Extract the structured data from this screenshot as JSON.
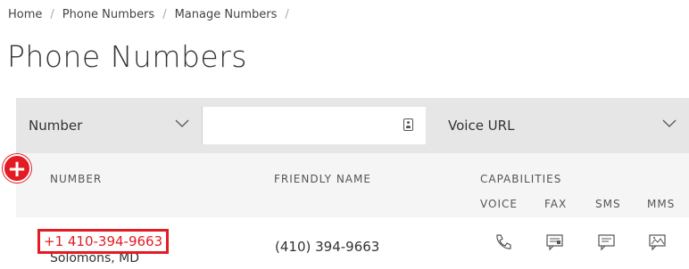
{
  "breadcrumb": {
    "items": [
      "Home",
      "Phone Numbers",
      "Manage Numbers"
    ],
    "separator": "/"
  },
  "page": {
    "title": "Phone Numbers"
  },
  "filters": {
    "field_select": {
      "value": "Number"
    },
    "search": {
      "value": "",
      "placeholder": ""
    },
    "url_select": {
      "value": "Voice URL"
    }
  },
  "table": {
    "headers": {
      "number": "NUMBER",
      "friendly_name": "FRIENDLY NAME",
      "capabilities": "CAPABILITIES"
    },
    "capability_headers": [
      "VOICE",
      "FAX",
      "SMS",
      "MMS"
    ],
    "rows": [
      {
        "number": "+1 410-394-9663",
        "location": "Solomons, MD",
        "friendly_name": "(410) 394-9663"
      }
    ]
  },
  "colors": {
    "accent": "#e31b23",
    "bar": "#e6e6e6",
    "header_bg": "#f5f5f5"
  },
  "icons": [
    "add-icon",
    "contact-card-icon",
    "chevron-down-icon",
    "phone-icon",
    "fax-icon",
    "sms-icon",
    "mms-icon"
  ]
}
